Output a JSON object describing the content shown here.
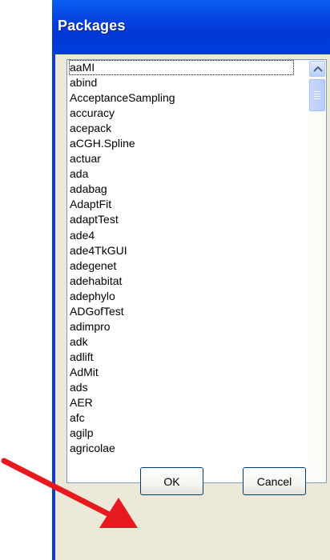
{
  "window": {
    "title": "Packages"
  },
  "packages": {
    "items": [
      "aaMI",
      "abind",
      "AcceptanceSampling",
      "accuracy",
      "acepack",
      "aCGH.Spline",
      "actuar",
      "ada",
      "adabag",
      "AdaptFit",
      "adaptTest",
      "ade4",
      "ade4TkGUI",
      "adegenet",
      "adehabitat",
      "adephylo",
      "ADGofTest",
      "adimpro",
      "adk",
      "adlift",
      "AdMit",
      "ads",
      "AER",
      "afc",
      "agilp",
      "agricolae"
    ],
    "focused_index": 0
  },
  "buttons": {
    "ok_label": "OK",
    "cancel_label": "Cancel"
  },
  "colors": {
    "titlebar": "#0543e0",
    "client": "#ece9d8",
    "annotation_arrow": "#e8181f"
  }
}
